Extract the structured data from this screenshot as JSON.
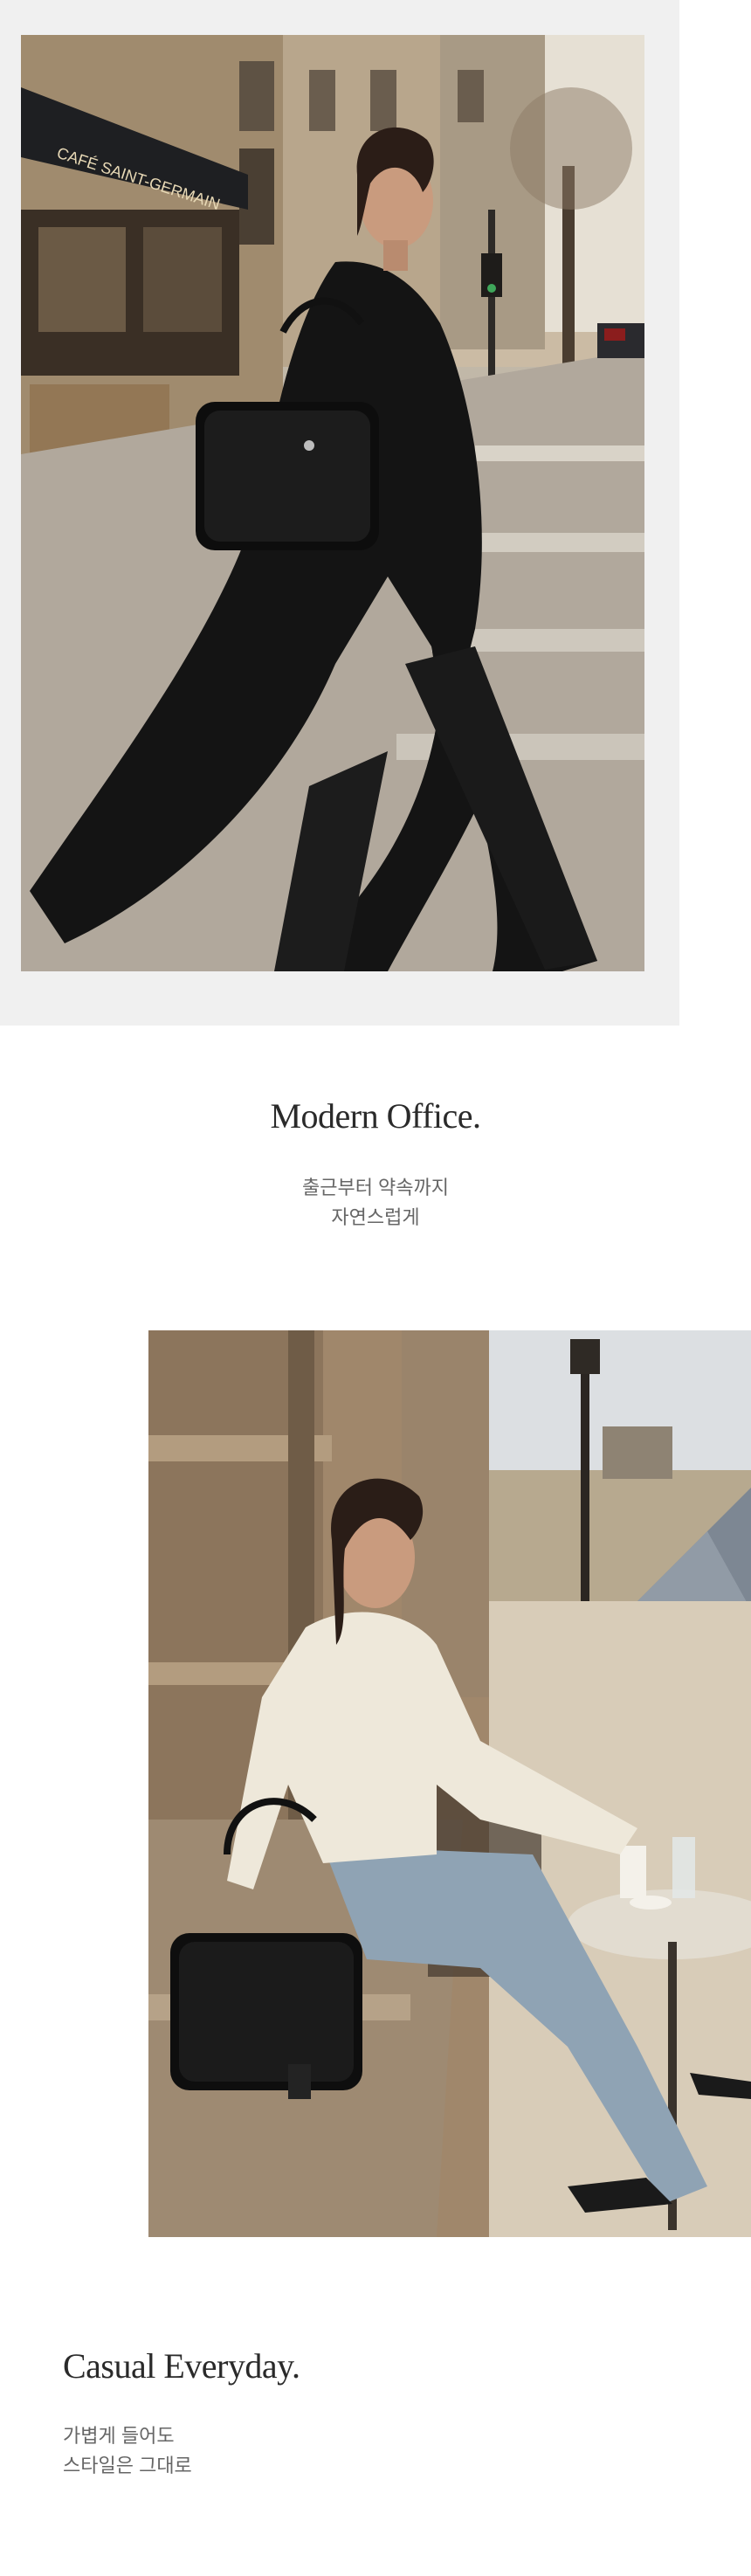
{
  "sections": [
    {
      "title": "Modern Office.",
      "subtitle_lines": [
        "출근부터 약속까지",
        "자연스럽게"
      ],
      "photo": {
        "description_icon": "photo-woman-walking-paris-street",
        "sign_text": "CAFÉ SAINT-GERMAIN"
      }
    },
    {
      "title": "Casual Everyday.",
      "subtitle_lines": [
        "가볍게 들어도",
        "스타일은 그대로"
      ],
      "photo": {
        "description_icon": "photo-woman-seated-louvre-cafe"
      }
    }
  ],
  "colors": {
    "panel_bg": "#f0f0f0",
    "title": "#2a2a2a",
    "subtitle": "#666666"
  }
}
